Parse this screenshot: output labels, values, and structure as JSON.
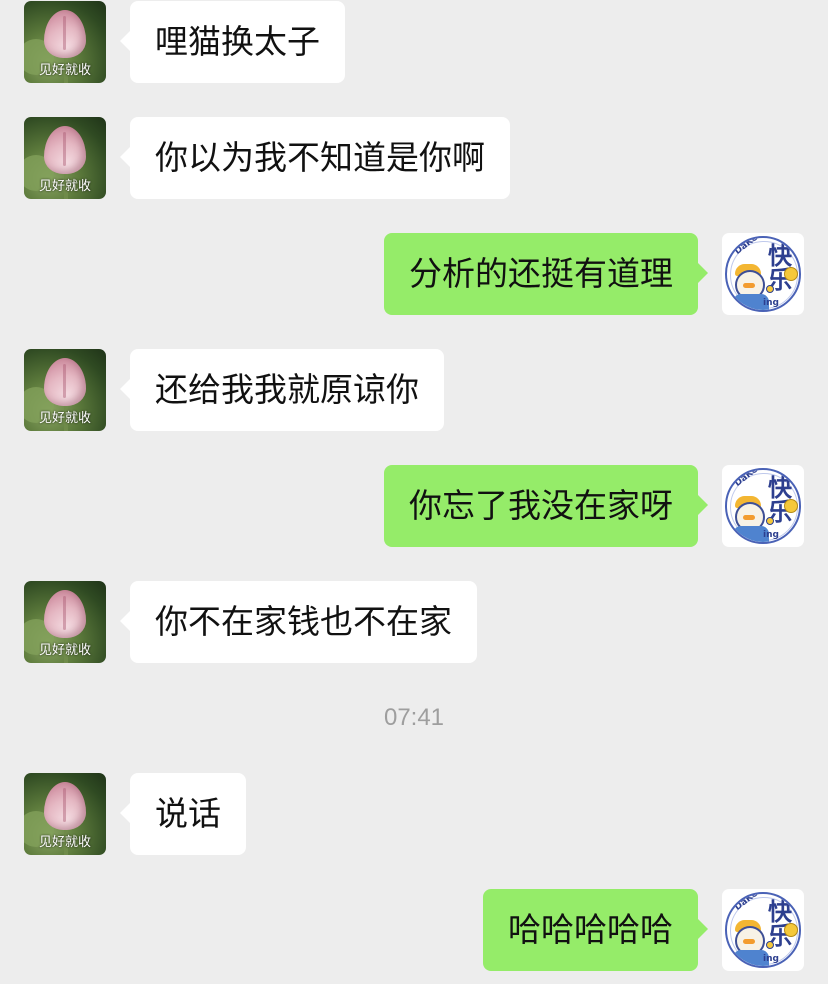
{
  "contact_avatar": {
    "caption": "见好就收"
  },
  "self_avatar": {
    "arc_text": "DaKe Duck",
    "hanzi": "快乐",
    "ing": "ing"
  },
  "messages": [
    {
      "from": "other",
      "text": "哩猫换太子"
    },
    {
      "from": "other",
      "text": "你以为我不知道是你啊"
    },
    {
      "from": "self",
      "text": "分析的还挺有道理"
    },
    {
      "from": "other",
      "text": "还给我我就原谅你"
    },
    {
      "from": "self",
      "text": "你忘了我没在家呀"
    },
    {
      "from": "other",
      "text": "你不在家钱也不在家"
    },
    {
      "from": "other",
      "text": "说话"
    },
    {
      "from": "self",
      "text": "哈哈哈哈哈"
    }
  ],
  "timestamp": "07:41"
}
